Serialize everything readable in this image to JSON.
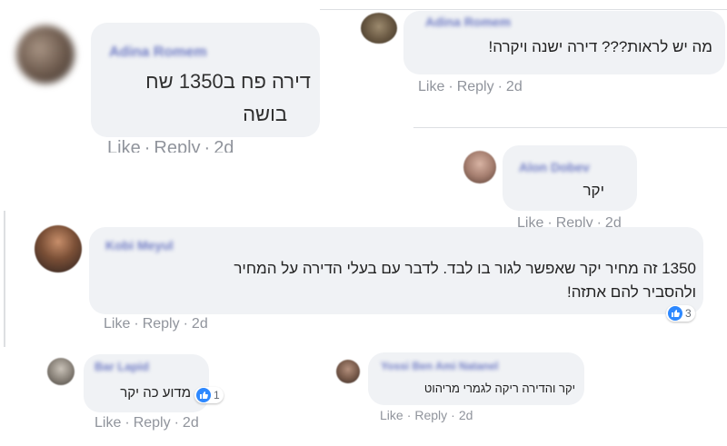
{
  "comments": [
    {
      "id": "c1",
      "author": "Adina Romem",
      "text_lines": [
        "דירה פח ב1350 שח",
        "בושה"
      ],
      "actions": {
        "like": "Like",
        "reply": "Reply",
        "time": "2d"
      }
    },
    {
      "id": "c2",
      "author": "Adina Romem",
      "text_lines": [
        "מה יש לראות??? דירה ישנה ויקרה!"
      ],
      "actions": {
        "like": "Like",
        "reply": "Reply",
        "time": "2d"
      }
    },
    {
      "id": "c3",
      "author": "Alon Dobev",
      "text_lines": [
        "יקר"
      ],
      "actions": {
        "like": "Like",
        "reply": "Reply",
        "time": "2d"
      }
    },
    {
      "id": "c4",
      "author": "Kobi Meyul",
      "text_lines": [
        "1350 זה מחיר יקר שאפשר לגור בו לבד. לדבר עם בעלי הדירה על המחיר",
        "ולהסביר להם אתזה!"
      ],
      "actions": {
        "like": "Like",
        "reply": "Reply",
        "time": "2d"
      },
      "reaction_count": "3"
    },
    {
      "id": "c5",
      "author": "Bar Lapid",
      "text_lines": [
        "מדוע כה יקר"
      ],
      "actions": {
        "like": "Like",
        "reply": "Reply",
        "time": "2d"
      },
      "reaction_count": "1"
    },
    {
      "id": "c6",
      "author": "Yossi Ben Ami Natanel",
      "text_lines": [
        "יקר והדירה ריקה לגמרי מריהוט"
      ],
      "actions": {
        "like": "Like",
        "reply": "Reply",
        "time": "2d"
      }
    }
  ],
  "colors": {
    "bubble": "#f0f2f5",
    "author": "#6f7bc4",
    "action": "#90949c",
    "like_blue": "#2d88ff"
  }
}
